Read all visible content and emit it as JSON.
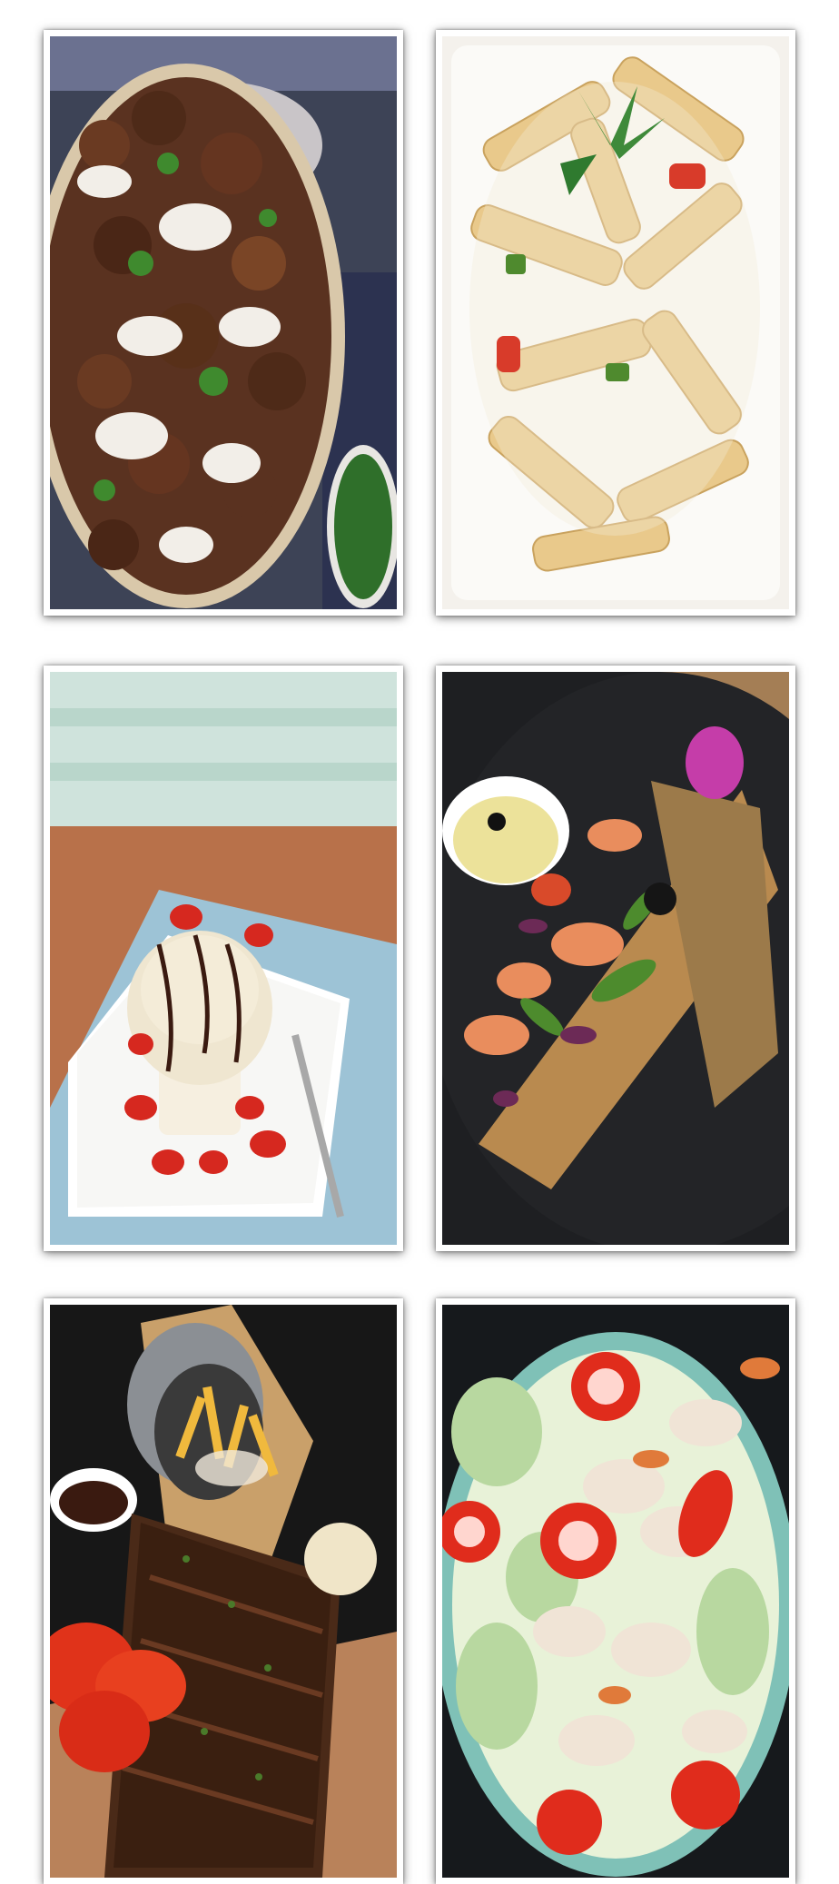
{
  "gallery": {
    "items": [
      {
        "icon": "meatball-potato-skillet-photo",
        "colors": {
          "bg": "#3d4356",
          "primary": "#5a3220",
          "accent": "#f2eee8"
        }
      },
      {
        "icon": "creamy-penne-pasta-photo",
        "colors": {
          "bg": "#f4f1ec",
          "primary": "#e9c98b",
          "accent": "#3f8a3a"
        }
      },
      {
        "icon": "ice-cream-dessert-photo",
        "colors": {
          "bg": "#b8714a",
          "primary": "#efe6d0",
          "accent": "#d6281f"
        }
      },
      {
        "icon": "shrimp-open-sandwich-photo",
        "colors": {
          "bg": "#1e1f22",
          "primary": "#b98a4f",
          "accent": "#4d8b2d"
        }
      },
      {
        "icon": "bbq-ribs-fries-photo",
        "colors": {
          "bg": "#171717",
          "primary": "#4a2a18",
          "accent": "#e0331a"
        }
      },
      {
        "icon": "chicken-tomato-salad-photo",
        "colors": {
          "bg": "#16191c",
          "primary": "#7fc1b7",
          "accent": "#e02c1c"
        }
      }
    ]
  }
}
